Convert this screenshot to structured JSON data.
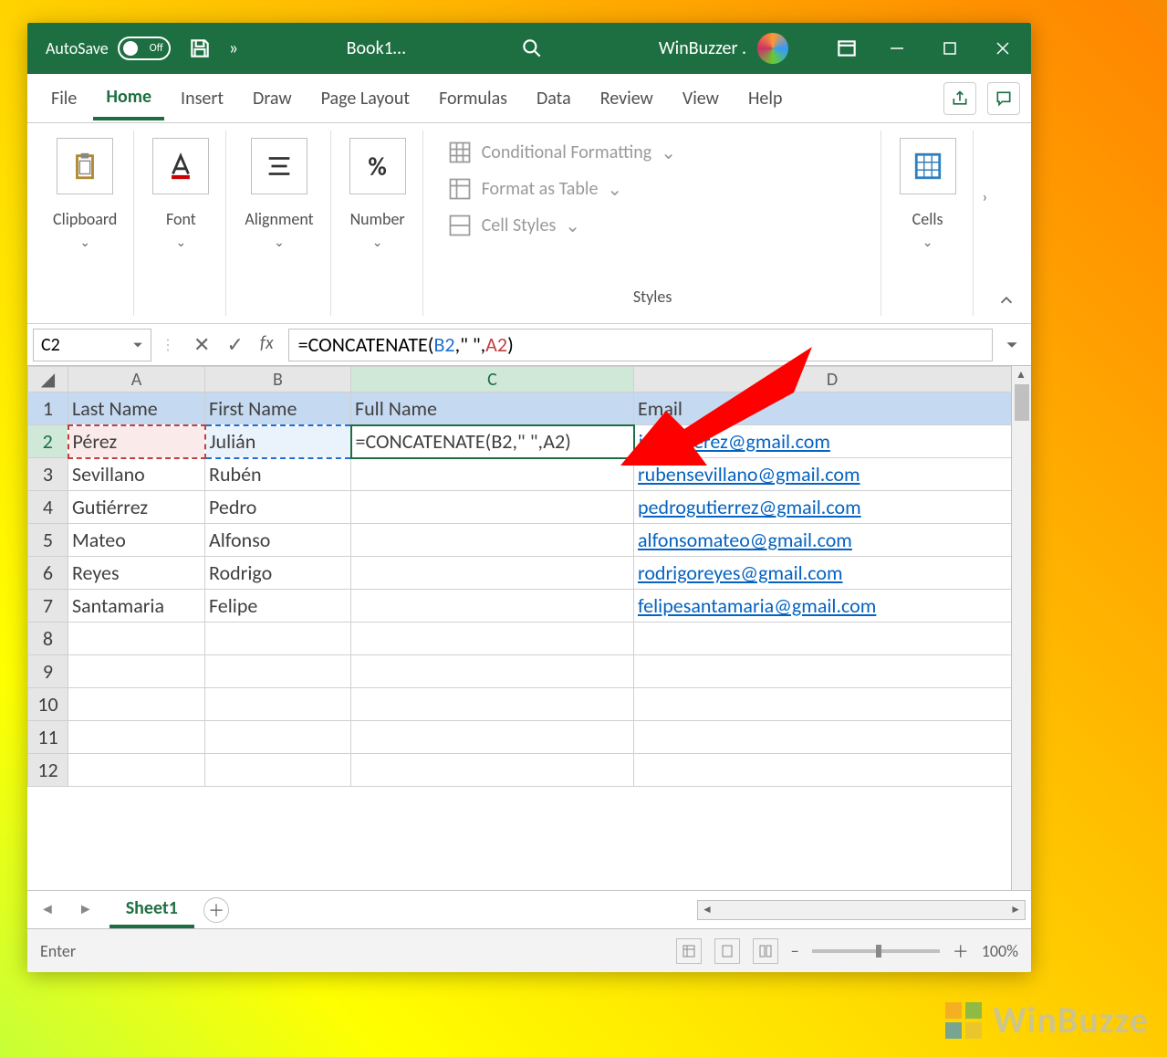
{
  "titlebar": {
    "autosave_label": "AutoSave",
    "autosave_state": "Off",
    "overflow_label": "»",
    "filename": "Book1…",
    "user_label": "WinBuzzer ."
  },
  "tabs": {
    "file": "File",
    "home": "Home",
    "insert": "Insert",
    "draw": "Draw",
    "page_layout": "Page Layout",
    "formulas": "Formulas",
    "data": "Data",
    "review": "Review",
    "view": "View",
    "help": "Help"
  },
  "ribbon": {
    "clipboard": "Clipboard",
    "font": "Font",
    "alignment": "Alignment",
    "number": "Number",
    "number_symbol": "%",
    "styles_label": "Styles",
    "cond_fmt": "Conditional Formatting",
    "fmt_table": "Format as Table",
    "cell_styles": "Cell Styles",
    "cells": "Cells"
  },
  "formula_bar": {
    "name": "C2",
    "fx_label": "fx",
    "formula_prefix": "=CONCATENATE(",
    "ref_b": "B2",
    "sep1": ",\" \",",
    "ref_a": "A2",
    "suffix": ")"
  },
  "headers": {
    "A": "A",
    "B": "B",
    "C": "C",
    "D": "D"
  },
  "data_headers": {
    "last": "Last Name",
    "first": "First Name",
    "full": "Full Name",
    "email": "Email"
  },
  "rows": [
    {
      "n": "1"
    },
    {
      "n": "2",
      "last": "Pérez",
      "first": "Julián",
      "c": "=CONCATENATE(B2,\" \",A2)",
      "email": "julianperez@gmail.com"
    },
    {
      "n": "3",
      "last": "Sevillano",
      "first": "Rubén",
      "email": "rubensevillano@gmail.com"
    },
    {
      "n": "4",
      "last": "Gutiérrez",
      "first": "Pedro",
      "email": "pedrogutierrez@gmail.com"
    },
    {
      "n": "5",
      "last": "Mateo",
      "first": "Alfonso",
      "email": "alfonsomateo@gmail.com"
    },
    {
      "n": "6",
      "last": "Reyes",
      "first": "Rodrigo",
      "email": "rodrigoreyes@gmail.com"
    },
    {
      "n": "7",
      "last": "Santamaria",
      "first": "Felipe",
      "email": "felipesantamaria@gmail.com"
    },
    {
      "n": "8"
    },
    {
      "n": "9"
    },
    {
      "n": "10"
    },
    {
      "n": "11"
    },
    {
      "n": "12"
    }
  ],
  "active_formula": {
    "prefix": "=CONCATENATE(",
    "ref_b": "B2",
    "sep": ",\" \",",
    "ref_a": "A2",
    "suffix": ")"
  },
  "sheets": {
    "sheet1": "Sheet1"
  },
  "status": {
    "mode": "Enter",
    "zoom": "100%"
  },
  "watermark": {
    "text": "WinBuzze"
  }
}
